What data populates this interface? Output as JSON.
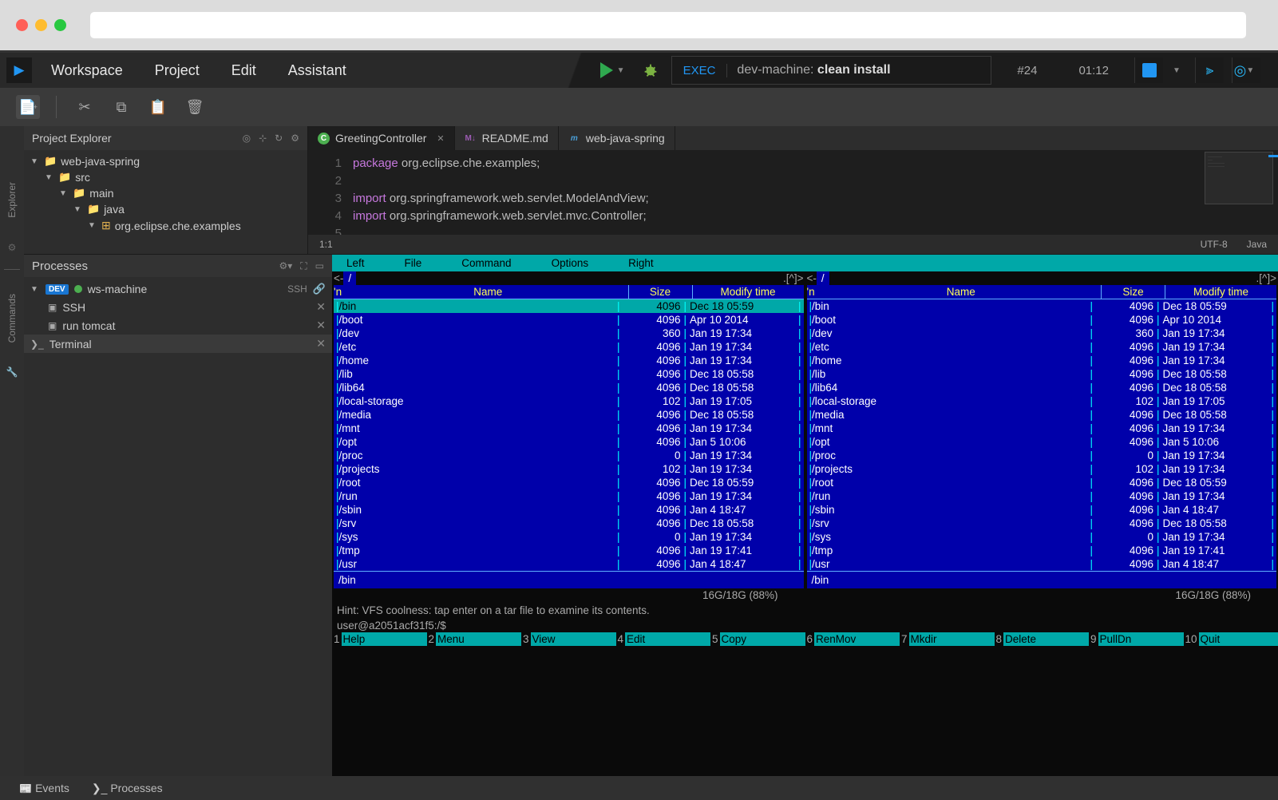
{
  "menu": {
    "workspace": "Workspace",
    "project": "Project",
    "edit": "Edit",
    "assistant": "Assistant"
  },
  "exec": {
    "label": "EXEC",
    "prefix": "dev-machine: ",
    "cmd": "clean install",
    "run": "#24",
    "time": "01:12"
  },
  "pe": {
    "title": "Project Explorer",
    "project": "web-java-spring",
    "src": "src",
    "main": "main",
    "java": "java",
    "pkg": "org.eclipse.che.examples"
  },
  "tabs": {
    "t1": "GreetingController",
    "t2": "README.md",
    "t3": "web-java-spring"
  },
  "code": {
    "l1a": "package",
    "l1b": " org.eclipse.che.examples;",
    "l3a": "import",
    "l3b": " org.springframework.web.servlet.ModelAndView;",
    "l4a": "import",
    "l4b": " org.springframework.web.servlet.mvc.Controller;"
  },
  "ed_status": {
    "pos": "1:1",
    "enc": "UTF-8",
    "lang": "Java"
  },
  "proc": {
    "title": "Processes",
    "machine": "ws-machine",
    "dev": "DEV",
    "sshlabel": "SSH",
    "items": {
      "ssh": "SSH",
      "tomcat": "run tomcat",
      "terminal": "Terminal"
    }
  },
  "mc": {
    "menu": {
      "left": "Left",
      "file": "File",
      "command": "Command",
      "options": "Options",
      "right": "Right"
    },
    "head": {
      "name": "Name",
      "size": "Size",
      "mtime": "Modify time"
    },
    "path": "/",
    "rows": [
      {
        "n": "/bin",
        "s": "4096",
        "m": "Dec 18 05:59"
      },
      {
        "n": "/boot",
        "s": "4096",
        "m": "Apr 10  2014"
      },
      {
        "n": "/dev",
        "s": "360",
        "m": "Jan 19 17:34"
      },
      {
        "n": "/etc",
        "s": "4096",
        "m": "Jan 19 17:34"
      },
      {
        "n": "/home",
        "s": "4096",
        "m": "Jan 19 17:34"
      },
      {
        "n": "/lib",
        "s": "4096",
        "m": "Dec 18 05:58"
      },
      {
        "n": "/lib64",
        "s": "4096",
        "m": "Dec 18 05:58"
      },
      {
        "n": "/local-storage",
        "s": "102",
        "m": "Jan 19 17:05"
      },
      {
        "n": "/media",
        "s": "4096",
        "m": "Dec 18 05:58"
      },
      {
        "n": "/mnt",
        "s": "4096",
        "m": "Jan 19 17:34"
      },
      {
        "n": "/opt",
        "s": "4096",
        "m": "Jan  5 10:06"
      },
      {
        "n": "/proc",
        "s": "0",
        "m": "Jan 19 17:34"
      },
      {
        "n": "/projects",
        "s": "102",
        "m": "Jan 19 17:34"
      },
      {
        "n": "/root",
        "s": "4096",
        "m": "Dec 18 05:59"
      },
      {
        "n": "/run",
        "s": "4096",
        "m": "Jan 19 17:34"
      },
      {
        "n": "/sbin",
        "s": "4096",
        "m": "Jan  4 18:47"
      },
      {
        "n": "/srv",
        "s": "4096",
        "m": "Dec 18 05:58"
      },
      {
        "n": "/sys",
        "s": "0",
        "m": "Jan 19 17:34"
      },
      {
        "n": "/tmp",
        "s": "4096",
        "m": "Jan 19 17:41"
      },
      {
        "n": "/usr",
        "s": "4096",
        "m": "Jan  4 18:47"
      }
    ],
    "foot": "/bin",
    "stats": "16G/18G (88%)",
    "hint": "Hint: VFS coolness: tap enter on a tar file to examine its contents.",
    "prompt": "user@a2051acf31f5:/$",
    "fn": {
      "1": "Help",
      "2": "Menu",
      "3": "View",
      "4": "Edit",
      "5": "Copy",
      "6": "RenMov",
      "7": "Mkdir",
      "8": "Delete",
      "9": "PullDn",
      "10": "Quit"
    }
  },
  "bottom": {
    "events": "Events",
    "processes": "Processes"
  }
}
